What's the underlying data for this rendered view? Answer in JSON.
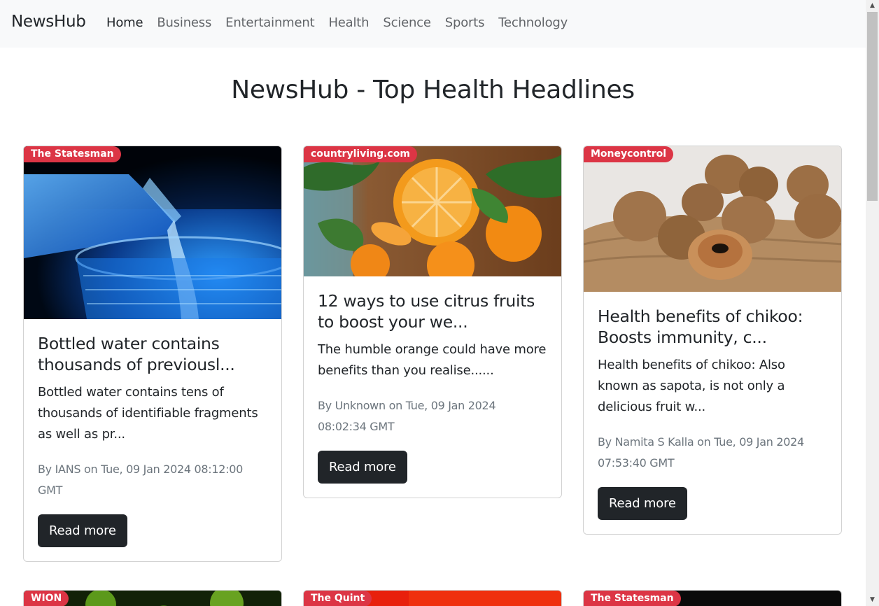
{
  "nav": {
    "brand": "NewsHub",
    "links": [
      {
        "label": "Home",
        "active": true
      },
      {
        "label": "Business"
      },
      {
        "label": "Entertainment"
      },
      {
        "label": "Health"
      },
      {
        "label": "Science"
      },
      {
        "label": "Sports"
      },
      {
        "label": "Technology"
      }
    ]
  },
  "page": {
    "title": "NewsHub - Top Health Headlines"
  },
  "articles": [
    {
      "source": "The Statesman",
      "title": "Bottled water contains thousands of previousl...",
      "description": "Bottled water contains tens of thousands of identifiable fragments as well as pr...",
      "meta": "By IANS on Tue, 09 Jan 2024 08:12:00 GMT",
      "button": "Read more"
    },
    {
      "source": "countryliving.com",
      "title": "12 ways to use citrus fruits to boost your we...",
      "description": "The humble orange could have more benefits than you realise......",
      "meta": "By Unknown on Tue, 09 Jan 2024 08:02:34 GMT",
      "button": "Read more"
    },
    {
      "source": "Moneycontrol",
      "title": "Health benefits of chikoo: Boosts immunity, c...",
      "description": "Health benefits of chikoo: Also known as sapota, is not only a delicious fruit w...",
      "meta": "By Namita S Kalla on Tue, 09 Jan 2024 07:53:40 GMT",
      "button": "Read more"
    },
    {
      "source": "WION"
    },
    {
      "source": "The Quint"
    },
    {
      "source": "The Statesman"
    }
  ],
  "colors": {
    "badge": "#dc3545",
    "button": "#212529",
    "navbar_bg": "#f8f9fa"
  }
}
